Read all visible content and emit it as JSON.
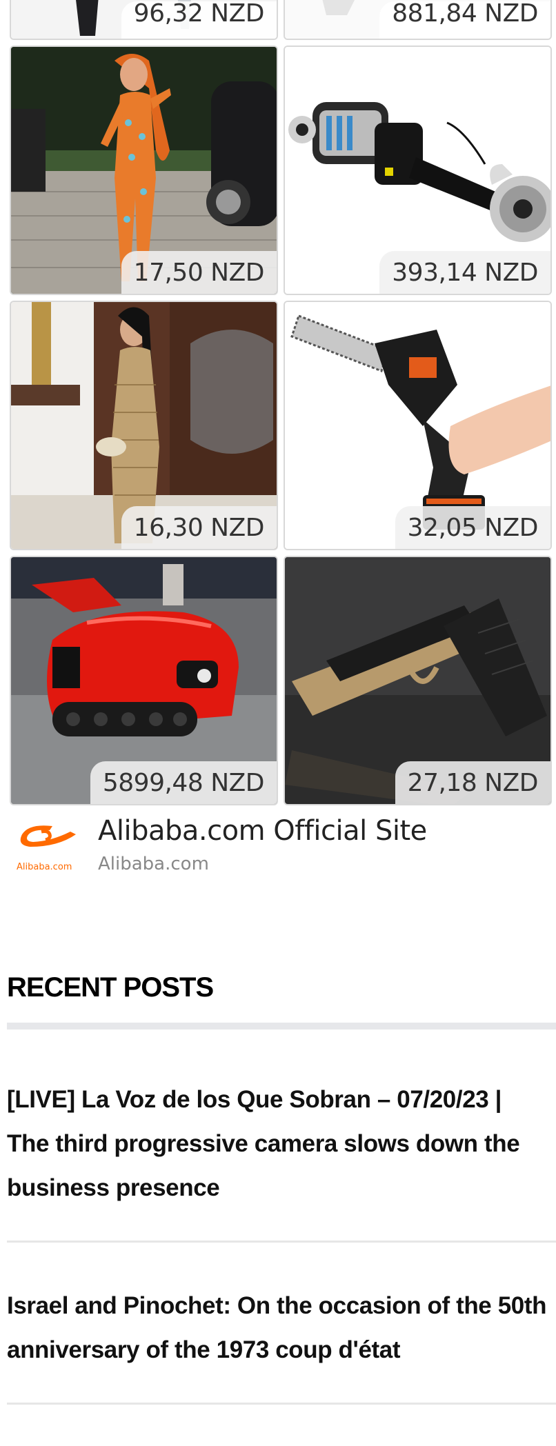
{
  "ads": {
    "tiles": [
      {
        "price": "96,32 NZD",
        "image": "fashion-leggings-photo"
      },
      {
        "price": "881,84 NZD",
        "image": "product-photo"
      },
      {
        "price": "17,50 NZD",
        "image": "patterned-catsuit-photo"
      },
      {
        "price": "393,14 NZD",
        "image": "electric-axle-motor-photo"
      },
      {
        "price": "16,30 NZD",
        "image": "crochet-dress-photo"
      },
      {
        "price": "32,05 NZD",
        "image": "mini-chainsaw-photo"
      },
      {
        "price": "5899,48 NZD",
        "image": "red-crawler-tractor-photo"
      },
      {
        "price": "27,18 NZD",
        "image": "toy-pistol-photo"
      }
    ],
    "source": {
      "title": "Alibaba.com Official Site",
      "domain": "Alibaba.com",
      "logo_text": "Alibaba.com",
      "brand_color": "#ff6a00"
    }
  },
  "recent_posts": {
    "heading": "RECENT POSTS",
    "posts": [
      {
        "title": "[LIVE] La Voz de los Que Sobran – 07/20/23 | The third progressive camera slows down the business presence"
      },
      {
        "title": "Israel and Pinochet: On the occasion of the 50th anniversary of the 1973 coup d'état"
      }
    ]
  }
}
